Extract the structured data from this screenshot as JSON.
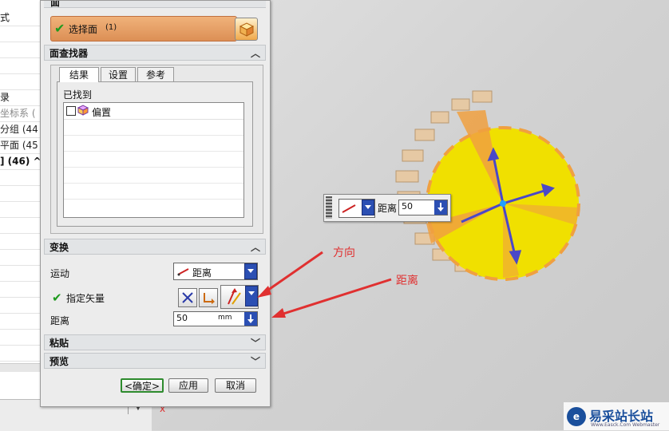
{
  "dialog": {
    "title": "面",
    "select_face": {
      "label": "选择面",
      "count": "(1)"
    },
    "face_finder": {
      "header": "面查找器",
      "tabs": [
        "结果",
        "设置",
        "参考"
      ],
      "found_label": "已找到",
      "found_items": [
        "偏置"
      ]
    },
    "transform": {
      "header": "变换",
      "motion_label": "运动",
      "motion_value": "距离",
      "vector_label": "指定矢量",
      "distance_label": "距离",
      "distance_value": "50",
      "distance_unit": "mm"
    },
    "paste_header": "粘贴",
    "preview_header": "预览",
    "buttons": {
      "ok": "<确定>",
      "apply": "应用",
      "cancel": "取消"
    }
  },
  "navigator": {
    "rows": [
      "式",
      "",
      "",
      "",
      "",
      "录",
      "坐标系 (",
      "分组 (44",
      "平面 (45",
      "] (46) ^",
      "",
      "",
      "",
      "",
      "",
      "",
      "",
      "",
      "",
      "",
      "",
      ""
    ]
  },
  "floating_input": {
    "label": "距离",
    "value": "50"
  },
  "annotations": {
    "direction": "方向",
    "distance": "距离"
  },
  "axis_label": "x",
  "watermark": {
    "text": "易采站长站",
    "sub": "Www.Easck.Com Webmaster"
  },
  "colors": {
    "gear_yellow": "#f0e000",
    "gear_orange": "#f0a040",
    "gear_tan": "#e8c8a0",
    "vector_blue": "#4040c0",
    "annotation_red": "#e03030",
    "select_bar": "#e8a060"
  }
}
